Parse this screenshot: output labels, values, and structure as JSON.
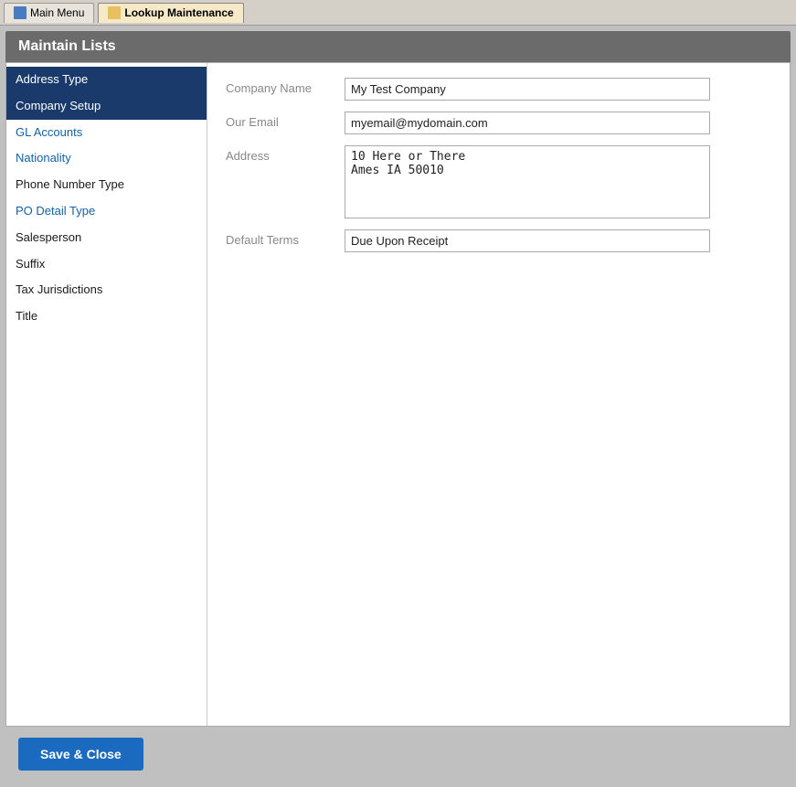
{
  "tabs": [
    {
      "id": "main-menu",
      "label": "Main Menu",
      "icon": "main-icon",
      "active": false
    },
    {
      "id": "lookup-maintenance",
      "label": "Lookup Maintenance",
      "icon": "lookup-icon",
      "active": true
    }
  ],
  "header": {
    "title": "Maintain Lists"
  },
  "sidebar": {
    "items": [
      {
        "id": "address-type",
        "label": "Address Type",
        "style": "normal",
        "selected": false
      },
      {
        "id": "company-setup",
        "label": "Company Setup",
        "style": "normal",
        "selected": true
      },
      {
        "id": "gl-accounts",
        "label": "GL Accounts",
        "style": "blue",
        "selected": false
      },
      {
        "id": "nationality",
        "label": "Nationality",
        "style": "blue",
        "selected": false
      },
      {
        "id": "phone-number-type",
        "label": "Phone Number Type",
        "style": "normal",
        "selected": false
      },
      {
        "id": "po-detail-type",
        "label": "PO Detail Type",
        "style": "blue",
        "selected": false
      },
      {
        "id": "salesperson",
        "label": "Salesperson",
        "style": "normal",
        "selected": false
      },
      {
        "id": "suffix",
        "label": "Suffix",
        "style": "normal",
        "selected": false
      },
      {
        "id": "tax-jurisdictions",
        "label": "Tax Jurisdictions",
        "style": "normal",
        "selected": false
      },
      {
        "id": "title",
        "label": "Title",
        "style": "normal",
        "selected": false
      }
    ]
  },
  "form": {
    "company_name_label": "Company Name",
    "company_name_value": "My Test Company",
    "our_email_label": "Our Email",
    "our_email_value": "myemail@mydomain.com",
    "address_label": "Address",
    "address_value": "10 Here or There\nAmes IA 50010",
    "default_terms_label": "Default Terms",
    "default_terms_value": "Due Upon Receipt"
  },
  "buttons": {
    "save_close_label": "Save & Close"
  }
}
